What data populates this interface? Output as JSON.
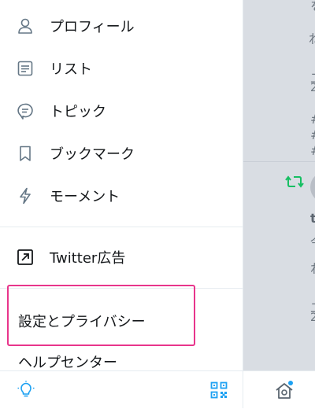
{
  "menu": {
    "items": [
      {
        "label": "プロフィール",
        "icon": "profile-icon"
      },
      {
        "label": "リスト",
        "icon": "list-icon"
      },
      {
        "label": "トピック",
        "icon": "topic-icon"
      },
      {
        "label": "ブックマーク",
        "icon": "bookmark-icon"
      },
      {
        "label": "モーメント",
        "icon": "moments-icon"
      }
    ],
    "ads": {
      "label": "Twitter広告",
      "icon": "external-link-icon"
    },
    "settings": {
      "label": "設定とプライバシー"
    },
    "help": {
      "label": "ヘルプセンター"
    }
  },
  "bottom_bar": {
    "left_icon": "lightbulb-icon",
    "right_icon": "qr-code-icon"
  },
  "timeline": {
    "snippets": [
      "を",
      "ね",
      "二",
      "2",
      "#",
      "#",
      "#",
      "t",
      "今",
      "ね",
      "二",
      "2"
    ],
    "home_icon": "home-icon"
  },
  "colors": {
    "accent": "#1da1f2",
    "highlight": "#e8358b",
    "retweet": "#17bf63",
    "overlay": "#d9dde3"
  }
}
